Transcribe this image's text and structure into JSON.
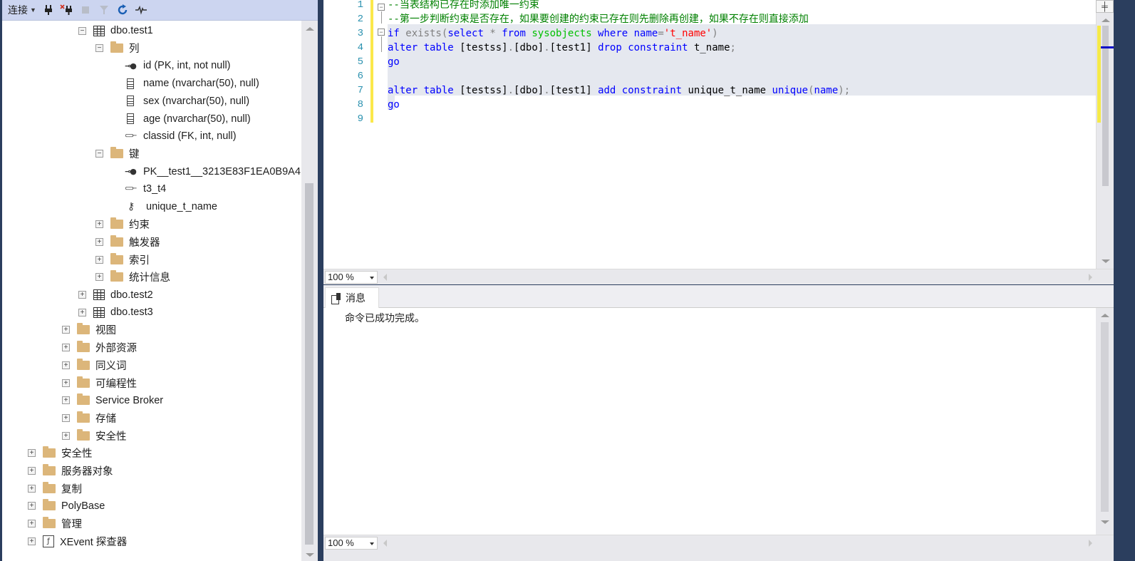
{
  "explorer": {
    "toolbar": {
      "connect_label": "连接",
      "icons": [
        "connect-icon",
        "disconnect-icon",
        "stop-icon",
        "filter-icon",
        "refresh-icon",
        "activity-monitor-icon"
      ]
    },
    "tree": [
      {
        "label": "dbo.test1",
        "icon": "table-icon",
        "expander": "minus"
      },
      {
        "label": "列",
        "icon": "folder-icon",
        "expander": "minus"
      },
      {
        "label": "id (PK, int, not null)",
        "icon": "primary-key-icon"
      },
      {
        "label": "name (nvarchar(50), null)",
        "icon": "column-icon"
      },
      {
        "label": "sex (nvarchar(50), null)",
        "icon": "column-icon"
      },
      {
        "label": "age (nvarchar(50), null)",
        "icon": "column-icon"
      },
      {
        "label": "classid (FK, int, null)",
        "icon": "foreign-key-icon"
      },
      {
        "label": "键",
        "icon": "folder-icon",
        "expander": "minus"
      },
      {
        "label": "PK__test1__3213E83F1EA0B9A4",
        "icon": "primary-key-icon"
      },
      {
        "label": "t3_t4",
        "icon": "foreign-key-icon"
      },
      {
        "label": "unique_t_name",
        "icon": "unique-key-icon"
      },
      {
        "label": "约束",
        "icon": "folder-icon",
        "expander": "plus"
      },
      {
        "label": "触发器",
        "icon": "folder-icon",
        "expander": "plus"
      },
      {
        "label": "索引",
        "icon": "folder-icon",
        "expander": "plus"
      },
      {
        "label": "统计信息",
        "icon": "folder-icon",
        "expander": "plus"
      },
      {
        "label": "dbo.test2",
        "icon": "table-icon",
        "expander": "plus"
      },
      {
        "label": "dbo.test3",
        "icon": "table-icon",
        "expander": "plus"
      },
      {
        "label": "视图",
        "icon": "folder-icon",
        "expander": "plus"
      },
      {
        "label": "外部资源",
        "icon": "folder-icon",
        "expander": "plus"
      },
      {
        "label": "同义词",
        "icon": "folder-icon",
        "expander": "plus"
      },
      {
        "label": "可编程性",
        "icon": "folder-icon",
        "expander": "plus"
      },
      {
        "label": "Service Broker",
        "icon": "folder-icon",
        "expander": "plus"
      },
      {
        "label": "存储",
        "icon": "folder-icon",
        "expander": "plus"
      },
      {
        "label": "安全性",
        "icon": "folder-icon",
        "expander": "plus"
      },
      {
        "label": "安全性",
        "icon": "folder-icon",
        "expander": "plus"
      },
      {
        "label": "服务器对象",
        "icon": "folder-icon",
        "expander": "plus"
      },
      {
        "label": "复制",
        "icon": "folder-icon",
        "expander": "plus"
      },
      {
        "label": "PolyBase",
        "icon": "folder-icon",
        "expander": "plus"
      },
      {
        "label": "管理",
        "icon": "folder-icon",
        "expander": "plus"
      },
      {
        "label": "XEvent 探查器",
        "icon": "xevent-icon",
        "expander": "plus"
      }
    ]
  },
  "editor": {
    "line_numbers": [
      "1",
      "2",
      "3",
      "4",
      "5",
      "6",
      "7",
      "8",
      "9"
    ],
    "lines": [
      [
        {
          "t": "--当表结构已存在时添加唯一约束",
          "c": "cmt"
        }
      ],
      [
        {
          "t": "--第一步判断约束是否存在，如果要创建的约束已存在则先删除再创建，如果不存在则直接添加",
          "c": "cmt"
        }
      ],
      [
        {
          "t": "if",
          "c": "kw"
        },
        {
          "t": " exists",
          "c": "gray"
        },
        {
          "t": "(",
          "c": "gray"
        },
        {
          "t": "select",
          "c": "kw"
        },
        {
          "t": " * ",
          "c": "gray"
        },
        {
          "t": "from",
          "c": "kw"
        },
        {
          "t": " sysobjects",
          "c": "sys"
        },
        {
          "t": " where",
          "c": "kw"
        },
        {
          "t": " name",
          "c": "kw"
        },
        {
          "t": "=",
          "c": "gray"
        },
        {
          "t": "'t_name'",
          "c": "str"
        },
        {
          "t": ")",
          "c": "gray"
        }
      ],
      [
        {
          "t": "alter",
          "c": "kw"
        },
        {
          "t": " table",
          "c": "kw"
        },
        {
          "t": " [testss]",
          "c": "blk"
        },
        {
          "t": ".",
          "c": "gray"
        },
        {
          "t": "[dbo]",
          "c": "blk"
        },
        {
          "t": ".",
          "c": "gray"
        },
        {
          "t": "[test1]",
          "c": "blk"
        },
        {
          "t": " drop",
          "c": "kw"
        },
        {
          "t": " constraint",
          "c": "kw"
        },
        {
          "t": " t_name",
          "c": "blk"
        },
        {
          "t": ";",
          "c": "gray"
        }
      ],
      [
        {
          "t": "go",
          "c": "kw"
        }
      ],
      [],
      [
        {
          "t": "alter",
          "c": "kw"
        },
        {
          "t": " table",
          "c": "kw"
        },
        {
          "t": " [testss]",
          "c": "blk"
        },
        {
          "t": ".",
          "c": "gray"
        },
        {
          "t": "[dbo]",
          "c": "blk"
        },
        {
          "t": ".",
          "c": "gray"
        },
        {
          "t": "[test1]",
          "c": "blk"
        },
        {
          "t": " add",
          "c": "kw"
        },
        {
          "t": " constraint",
          "c": "kw"
        },
        {
          "t": " unique_t_name",
          "c": "blk"
        },
        {
          "t": " unique",
          "c": "kw"
        },
        {
          "t": "(",
          "c": "gray"
        },
        {
          "t": "name",
          "c": "kw"
        },
        {
          "t": ")",
          "c": "gray"
        },
        {
          "t": ";",
          "c": "gray"
        }
      ],
      [
        {
          "t": "go",
          "c": "kw"
        }
      ],
      []
    ],
    "zoom": "100 %"
  },
  "results": {
    "tab_label": "消息",
    "message": "命令已成功完成。",
    "zoom": "100 %"
  }
}
